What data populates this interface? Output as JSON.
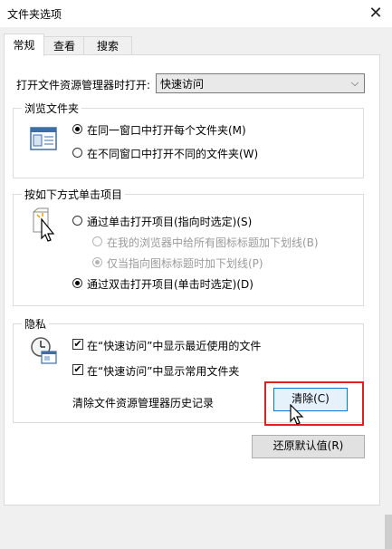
{
  "window": {
    "title": "文件夹选项",
    "close_glyph": "✕"
  },
  "tabs": [
    {
      "label": "常规",
      "active": true
    },
    {
      "label": "查看",
      "active": false
    },
    {
      "label": "搜索",
      "active": false
    }
  ],
  "general": {
    "open_label": "打开文件资源管理器时打开:",
    "open_value": "快速访问",
    "browse": {
      "legend": "浏览文件夹",
      "option_same": "在同一窗口中打开每个文件夹(M)",
      "option_new": "在不同窗口中打开不同的文件夹(W)"
    },
    "click": {
      "legend": "按如下方式单击项目",
      "option_single": "通过单击打开项目(指向时选定)(S)",
      "sub_all": "在我的浏览器中给所有图标标题加下划线(B)",
      "sub_point": "仅当指向图标标题时加下划线(P)",
      "option_double": "通过双击打开项目(单击时选定)(D)"
    },
    "privacy": {
      "legend": "隐私",
      "recent_files": "在“快速访问”中显示最近使用的文件",
      "frequent_folders": "在“快速访问”中显示常用文件夹",
      "clear_label": "清除文件资源管理器历史记录",
      "clear_button": "清除(C)"
    },
    "restore_button": "还原默认值(R)"
  },
  "colors": {
    "highlight_box": "#d22222",
    "accent": "#0078d7"
  },
  "icons": [
    "close-icon",
    "combo-arrow-icon",
    "folder-window-icon",
    "single-click-icon",
    "privacy-icon",
    "mouse-cursor-icon"
  ]
}
